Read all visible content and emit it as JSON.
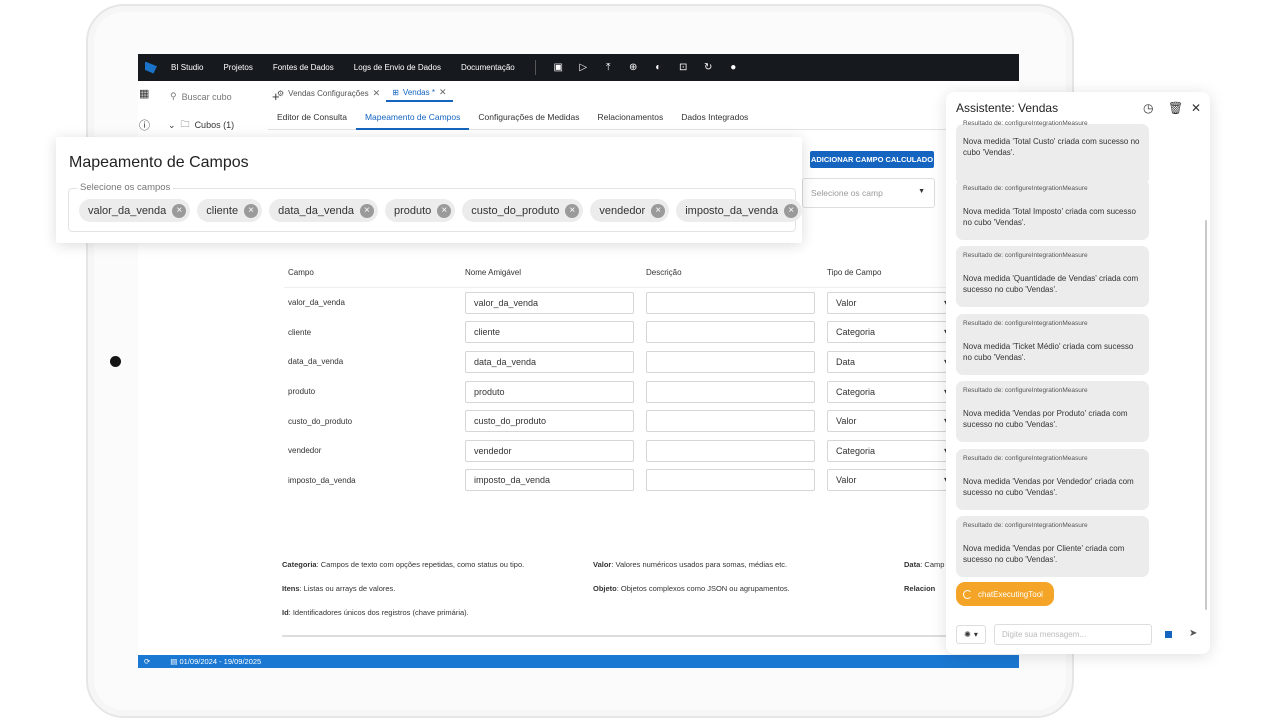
{
  "topbar": {
    "items": [
      "BI Studio",
      "Projetos",
      "Fontes de Dados",
      "Logs de Envio de Dados",
      "Documentação"
    ]
  },
  "tree": {
    "search_placeholder": "Buscar cubo",
    "cubes_label": "Cubos (1)"
  },
  "doc_tabs": [
    {
      "label": "Vendas Configurações"
    },
    {
      "label": "Vendas *"
    }
  ],
  "sub_tabs": [
    "Editor de Consulta",
    "Mapeamento de Campos",
    "Configurações de Medidas",
    "Relacionamentos",
    "Dados Integrados"
  ],
  "add_button": "ADICIONAR CAMPO CALCULADO",
  "select_placeholder": "Selecione os camp",
  "overlay": {
    "title": "Mapeamento de Campos",
    "field_label": "Selecione os campos",
    "chips": [
      "valor_da_venda",
      "cliente",
      "data_da_venda",
      "produto",
      "custo_do_produto",
      "vendedor",
      "imposto_da_venda"
    ]
  },
  "table": {
    "headers": [
      "Campo",
      "Nome Amigável",
      "Descrição",
      "Tipo de Campo"
    ],
    "rows": [
      {
        "campo": "valor_da_venda",
        "nome": "valor_da_venda",
        "tipo": "Valor"
      },
      {
        "campo": "cliente",
        "nome": "cliente",
        "tipo": "Categoria"
      },
      {
        "campo": "data_da_venda",
        "nome": "data_da_venda",
        "tipo": "Data"
      },
      {
        "campo": "produto",
        "nome": "produto",
        "tipo": "Categoria"
      },
      {
        "campo": "custo_do_produto",
        "nome": "custo_do_produto",
        "tipo": "Valor"
      },
      {
        "campo": "vendedor",
        "nome": "vendedor",
        "tipo": "Categoria"
      },
      {
        "campo": "imposto_da_venda",
        "nome": "imposto_da_venda",
        "tipo": "Valor"
      }
    ]
  },
  "legend": {
    "categoria_term": "Categoria",
    "categoria_desc": ": Campos de texto com opções repetidas, como status ou tipo.",
    "valor_term": "Valor",
    "valor_desc": ": Valores numéricos usados para somas, médias etc.",
    "data_term": "Data",
    "data_desc": ": Camp",
    "itens_term": "Itens",
    "itens_desc": ": Listas ou arrays de valores.",
    "objeto_term": "Objeto",
    "objeto_desc": ": Objetos complexos como JSON ou agrupamentos.",
    "relacion_term": "Relacion",
    "id_term": "Id",
    "id_desc": ": Identificadores únicos dos registros (chave primária)."
  },
  "statusbar": {
    "date_range": "01/09/2024 - 19/09/2025"
  },
  "assistant": {
    "title": "Assistente: Vendas",
    "messages": [
      {
        "head": "Resultado de: configureIntegrationMeasure",
        "body": "Nova medida 'Total Custo' criada com sucesso no cubo 'Vendas'."
      },
      {
        "head": "Resultado de: configureIntegrationMeasure",
        "body": "Nova medida 'Total Imposto' criada com sucesso no cubo 'Vendas'."
      },
      {
        "head": "Resultado de: configureIntegrationMeasure",
        "body": "Nova medida 'Quantidade de Vendas' criada com sucesso no cubo 'Vendas'."
      },
      {
        "head": "Resultado de: configureIntegrationMeasure",
        "body": "Nova medida 'Ticket Médio' criada com sucesso no cubo 'Vendas'."
      },
      {
        "head": "Resultado de: configureIntegrationMeasure",
        "body": "Nova medida 'Vendas por Produto' criada com sucesso no cubo 'Vendas'."
      },
      {
        "head": "Resultado de: configureIntegrationMeasure",
        "body": "Nova medida 'Vendas por Vendedor' criada com sucesso no cubo 'Vendas'."
      },
      {
        "head": "Resultado de: configureIntegrationMeasure",
        "body": "Nova medida 'Vendas por Cliente' criada com sucesso no cubo 'Vendas'."
      }
    ],
    "executing_label": "chatExecutingTool",
    "input_placeholder": "Digite sua mensagem..."
  }
}
